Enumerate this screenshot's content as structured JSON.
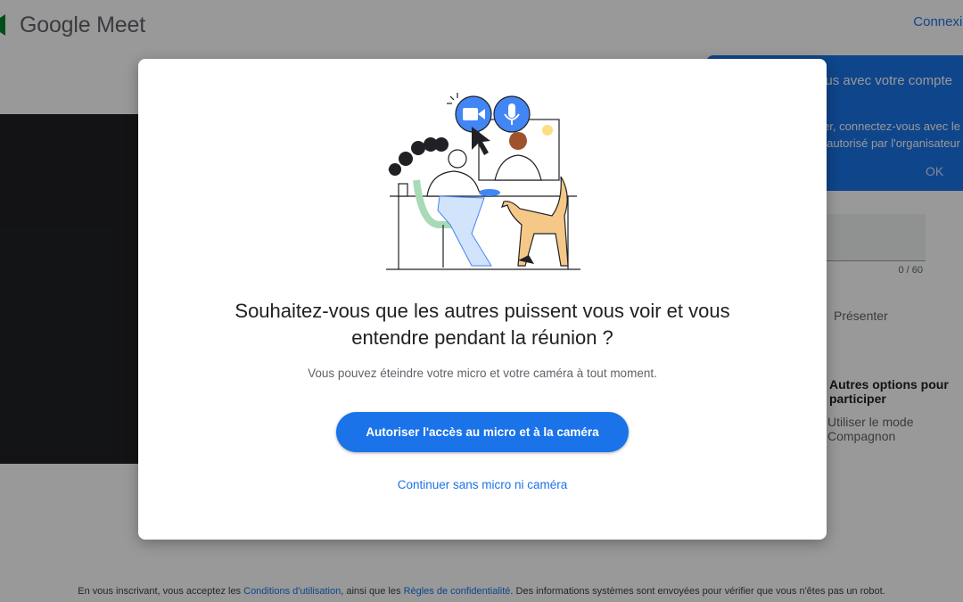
{
  "app": {
    "name": "Google Meet"
  },
  "header": {
    "connect_label": "Connexion"
  },
  "signin_popover": {
    "title": "Connectez-vous avec votre compte",
    "text_line1": "Pour participer, connectez-vous avec le",
    "text_line2": "compte autorisé par l'organisateur",
    "ok_label": "OK"
  },
  "name_field": {
    "char_count": "0 / 60"
  },
  "side_panel": {
    "present_label": "Présenter",
    "join_label": "Autres options pour participer",
    "companion_label": "Utiliser le mode Compagnon"
  },
  "dialog": {
    "title_line1": "Souhaitez-vous que les autres puissent vous voir et vous",
    "title_line2": "entendre pendant la réunion ?",
    "subtitle": "Vous pouvez éteindre votre micro et votre caméra à tout moment.",
    "allow_button": "Autoriser l'accès au micro et à la caméra",
    "continue_link": "Continuer sans micro ni caméra"
  },
  "footer": {
    "text_before": "En vous inscrivant, vous acceptez les ",
    "terms_link": "Conditions d'utilisation",
    "text_middle": ", ainsi que les ",
    "privacy_link": "Règles de confidentialité",
    "text_after": ". Des informations systèmes sont envoyées pour vérifier que vous n'êtes pas un robot."
  },
  "icons": {
    "meet_logo": "meet-logo-icon",
    "camera": "video-camera-icon",
    "microphone": "microphone-icon",
    "cursor": "cursor-icon"
  },
  "colors": {
    "accent": "#1a73e8",
    "scrim": "rgba(0,0,0,0.4)",
    "video_tile": "#202124"
  }
}
